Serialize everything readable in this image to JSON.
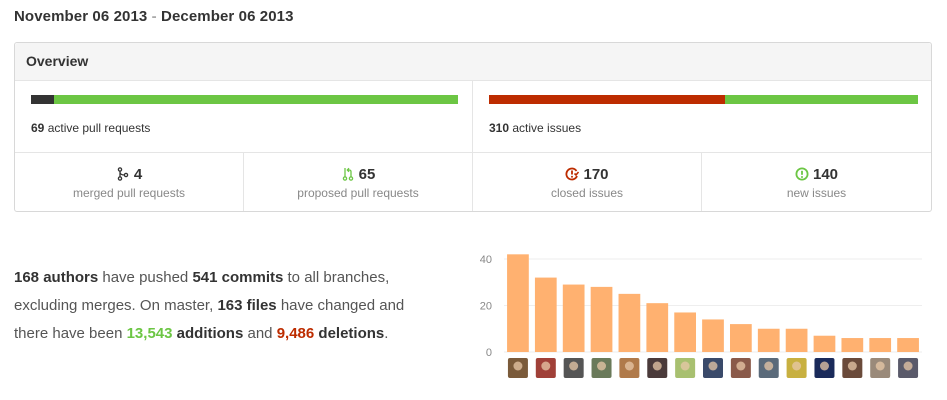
{
  "date_range": {
    "start": "November 06 2013",
    "separator": "-",
    "end": "December 06 2013"
  },
  "overview": {
    "title": "Overview",
    "pull_requests": {
      "count": "69",
      "label": "active pull requests",
      "merged_fraction": 0.055,
      "colors": [
        "#333333",
        "#6cc644"
      ]
    },
    "issues": {
      "count": "310",
      "label": "active issues",
      "closed_fraction": 0.55,
      "colors": [
        "#bd2c00",
        "#6cc644"
      ]
    },
    "stats": [
      {
        "icon": "merged-pr-icon",
        "value": "4",
        "label": "merged pull requests",
        "color": "#333333"
      },
      {
        "icon": "proposed-pr-icon",
        "value": "65",
        "label": "proposed pull requests",
        "color": "#6cc644"
      },
      {
        "icon": "closed-issue-icon",
        "value": "170",
        "label": "closed issues",
        "color": "#bd2c00"
      },
      {
        "icon": "new-issue-icon",
        "value": "140",
        "label": "new issues",
        "color": "#6cc644"
      }
    ]
  },
  "summary": {
    "authors": "168 authors",
    "t1": " have pushed ",
    "commits": "541 commits",
    "t2": " to all branches, excluding merges. On master, ",
    "files": "163 files",
    "t3": " have changed and there have been ",
    "additions_num": "13,543",
    "additions_word": " additions",
    "t4": " and ",
    "deletions_num": "9,486",
    "deletions_word": " deletions",
    "t5": "."
  },
  "chart_data": {
    "type": "bar",
    "yticks": [
      0,
      20,
      40
    ],
    "ylim": [
      0,
      43
    ],
    "values": [
      42,
      32,
      29,
      28,
      25,
      21,
      17,
      14,
      12,
      10,
      10,
      7,
      6,
      6,
      6
    ],
    "bar_color": "#ffb170",
    "xlabel": "",
    "ylabel": ""
  }
}
